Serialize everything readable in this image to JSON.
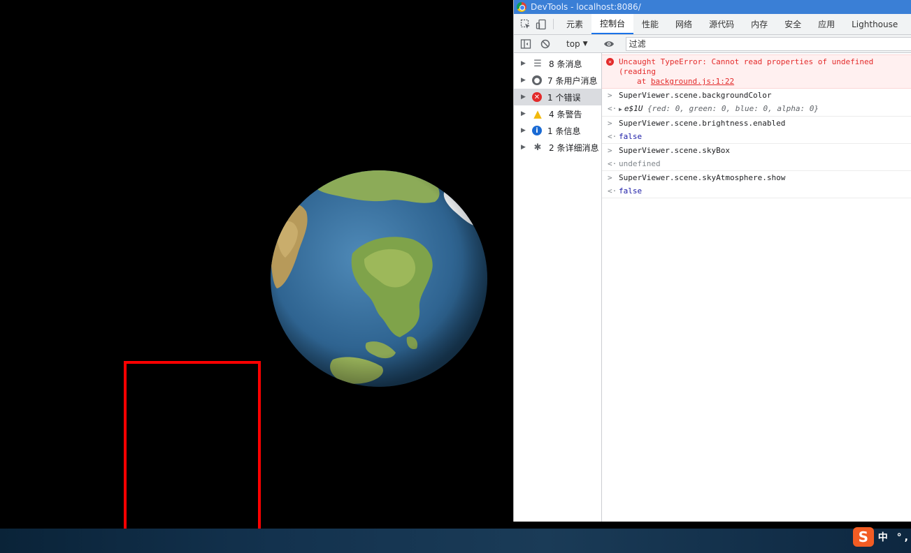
{
  "window": {
    "title": "DevTools - localhost:8086/"
  },
  "tabs": [
    {
      "label": "元素"
    },
    {
      "label": "控制台",
      "active": true
    },
    {
      "label": "性能"
    },
    {
      "label": "网络"
    },
    {
      "label": "源代码"
    },
    {
      "label": "内存"
    },
    {
      "label": "安全"
    },
    {
      "label": "应用"
    },
    {
      "label": "Lighthouse"
    }
  ],
  "console_toolbar": {
    "context": "top",
    "filter_value": "过滤"
  },
  "sidebar": {
    "items": [
      {
        "label": "8 条消息",
        "icon": "list-icon"
      },
      {
        "label": "7 条用户消息",
        "icon": "user-icon"
      },
      {
        "label": "1 个错误",
        "icon": "error-icon",
        "selected": true
      },
      {
        "label": "4 条警告",
        "icon": "warning-icon"
      },
      {
        "label": "1 条信息",
        "icon": "info-icon"
      },
      {
        "label": "2 条详细消息",
        "icon": "bug-icon"
      }
    ]
  },
  "console": {
    "error": {
      "message": "Uncaught TypeError: Cannot read properties of undefined (reading",
      "at_prefix": "at",
      "location": "background.js:1:22"
    },
    "entries": [
      {
        "input": "SuperViewer.scene.backgroundColor",
        "result_name": "e$1U",
        "result_body": "{red: 0, green: 0, blue: 0, alpha: 0}"
      },
      {
        "input": "SuperViewer.scene.brightness.enabled",
        "result": "false"
      },
      {
        "input": "SuperViewer.scene.skyBox",
        "result": "undefined"
      },
      {
        "input": "SuperViewer.scene.skyAtmosphere.show",
        "result": "false"
      }
    ]
  },
  "ime": {
    "logo": "S",
    "text": "中 °,"
  },
  "colors": {
    "annotation_rect": "#ff0000",
    "titlebar": "#3a7fd6",
    "error_text": "#e32a2a",
    "active_tab_underline": "#1a73e8"
  }
}
